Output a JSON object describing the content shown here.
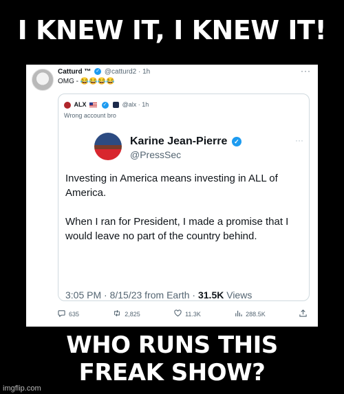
{
  "meme": {
    "top_text": "I KNEW IT, I KNEW IT!",
    "bottom_line1": "WHO RUNS THIS",
    "bottom_line2": "FREAK SHOW?",
    "watermark": "imgflip.com"
  },
  "tweet": {
    "name": "Catturd ™",
    "handle": "@catturd2",
    "time": "· 1h",
    "text": "OMG - 😂😂😂😂",
    "more": "···"
  },
  "quoted": {
    "name": "ALX",
    "handle": "@alx",
    "time": "· 1h",
    "text": "Wrong account bro"
  },
  "inner_tweet": {
    "name": "Karine Jean-Pierre",
    "handle": "@PressSec",
    "para1": "Investing in America means investing in ALL of America.",
    "para2": "When I ran for President, I made a promise that I would leave no part of the country behind.",
    "meta_prefix": "3:05 PM · 8/15/23 from Earth · ",
    "views_count": "31.5K",
    "views_label": " Views",
    "more": "···"
  },
  "actions": {
    "replies": "635",
    "retweets": "2,825",
    "likes": "11.3K",
    "views": "288.5K"
  },
  "icons": {
    "reply": "speech-bubble-icon",
    "retweet": "retweet-icon",
    "like": "heart-icon",
    "views": "bar-chart-icon",
    "share": "share-icon"
  },
  "colors": {
    "verified_blue": "#1d9bf0",
    "text_primary": "#0f1419",
    "text_secondary": "#536471"
  }
}
